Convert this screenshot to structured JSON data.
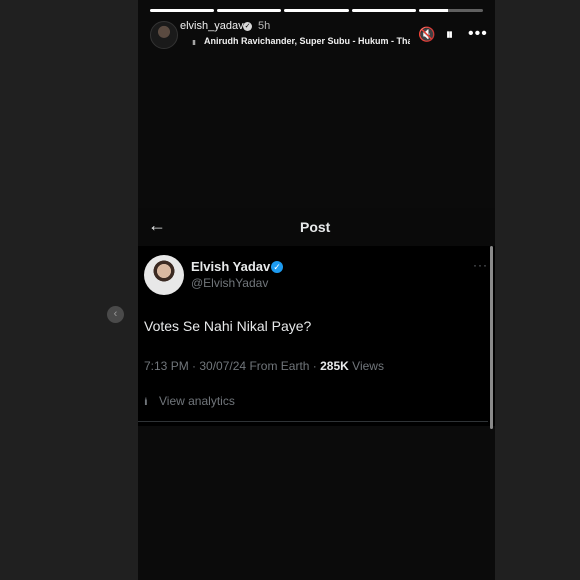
{
  "story": {
    "progress": [
      1,
      1,
      1,
      1,
      0.45
    ],
    "username": "elvish_yadav",
    "verified_icon": "verified-badge-icon",
    "time_ago": "5h",
    "music": "Anirudh Ravichander, Super Subu - Hukum - Tha",
    "controls": {
      "mute_icon": "🔇",
      "pause_icon": "⏸",
      "more_icon": "•••"
    }
  },
  "post": {
    "back_icon": "←",
    "header_title": "Post",
    "author_name": "Elvish Yadav",
    "author_handle": "@ElvishYadav",
    "more_icon": "···",
    "text": "Votes Se Nahi Nikal Paye?",
    "time": "7:13 PM",
    "date": "30/07/24",
    "location": "From Earth",
    "views_count": "285K",
    "views_label": "Views",
    "analytics_label": "View analytics",
    "accent": "#1d9bf0"
  },
  "nav": {
    "prev_icon": "‹"
  }
}
